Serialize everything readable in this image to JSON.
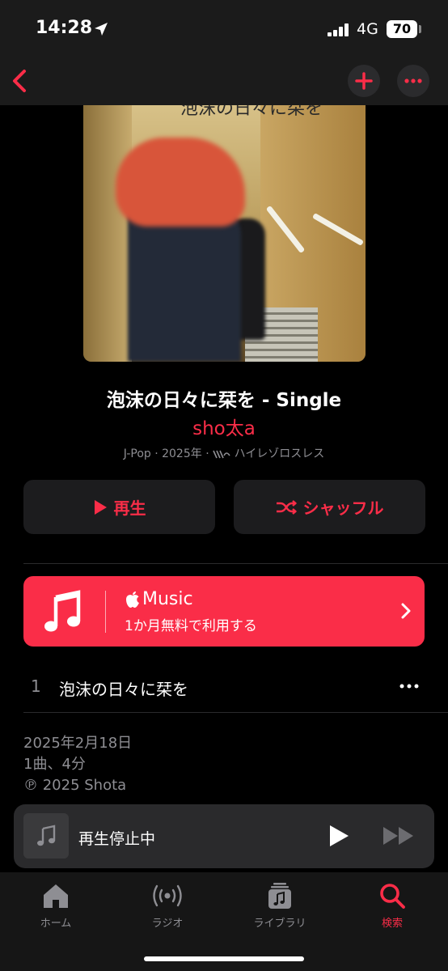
{
  "status_bar": {
    "time": "14:28",
    "network": "4G",
    "battery": "70"
  },
  "nav": {
    "back_icon": "chevron-left-icon",
    "add_icon": "plus-icon",
    "more_icon": "ellipsis-icon",
    "accent": "#fa2d48"
  },
  "album": {
    "artwork_title": "泡沫の日々に栞を",
    "title": "泡沫の日々に栞を - Single",
    "artist": "sho太a",
    "meta": "J-Pop · 2025年 ·",
    "format": "ハイレゾロスレス"
  },
  "actions": {
    "play_label": "再生",
    "shuffle_label": "シャッフル"
  },
  "banner": {
    "brand": "Music",
    "subtitle": "1か月無料で利用する",
    "color": "#fa2d48"
  },
  "tracks": [
    {
      "number": "1",
      "title": "泡沫の日々に栞を"
    }
  ],
  "footer": {
    "release_date": "2025年2月18日",
    "summary": "1曲、4分",
    "copyright": "℗ 2025 Shota"
  },
  "mini_player": {
    "title": "再生停止中"
  },
  "tabs": [
    {
      "label": "ホーム",
      "icon": "home-icon"
    },
    {
      "label": "ラジオ",
      "icon": "radio-icon"
    },
    {
      "label": "ライブラリ",
      "icon": "library-icon"
    },
    {
      "label": "検索",
      "icon": "search-icon",
      "active": true
    }
  ]
}
